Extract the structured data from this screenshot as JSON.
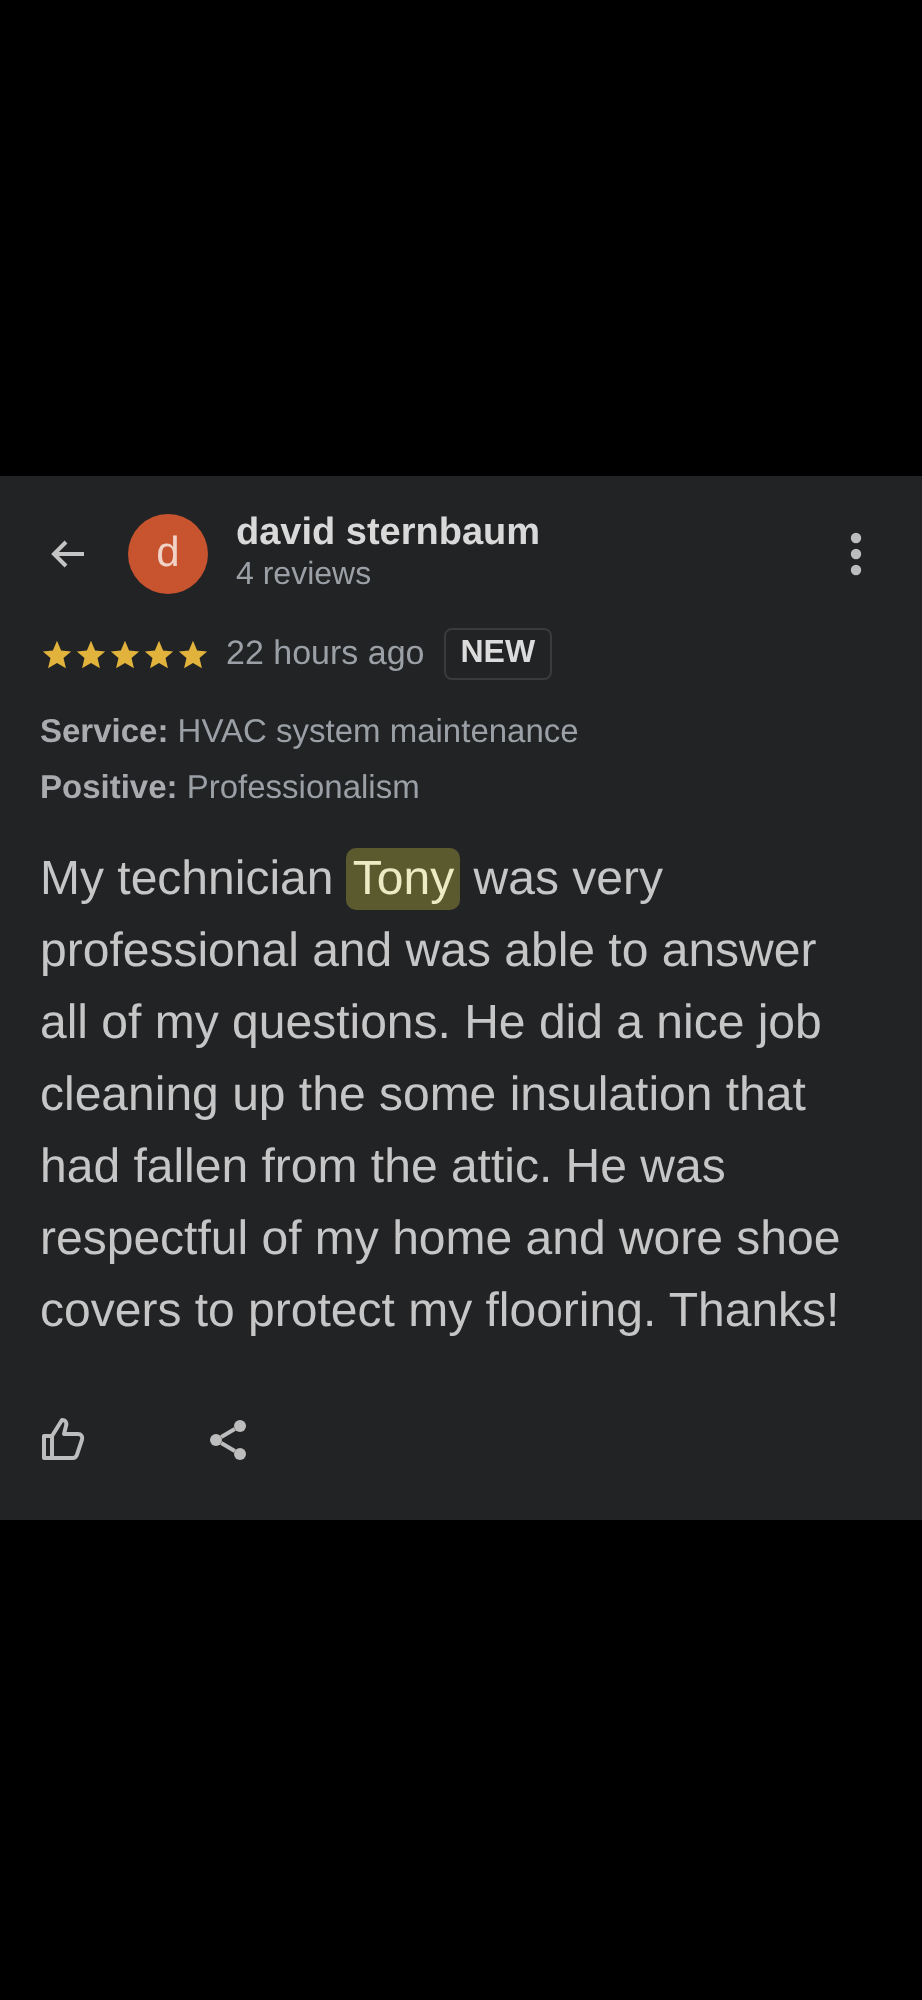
{
  "reviewer": {
    "initial": "d",
    "name": "david sternbaum",
    "reviews": "4 reviews"
  },
  "rating": {
    "stars": 5,
    "time": "22 hours ago",
    "badge": "NEW"
  },
  "details": [
    "**Service:** HVAC system maintenance",
    "**Positive:** Professionalism"
  ],
  "review": [
    {
      "text": "My technician ",
      "highlighted": false
    },
    {
      "text": "Tony",
      "highlighted": true
    },
    {
      "text": " was very professional and was able to answer all of my questions. He did a nice job cleaning up the some insulation that had fallen from the attic. He was respectful of my home and wore shoe covers to protect my flooring. Thanks!",
      "highlighted": false
    }
  ]
}
